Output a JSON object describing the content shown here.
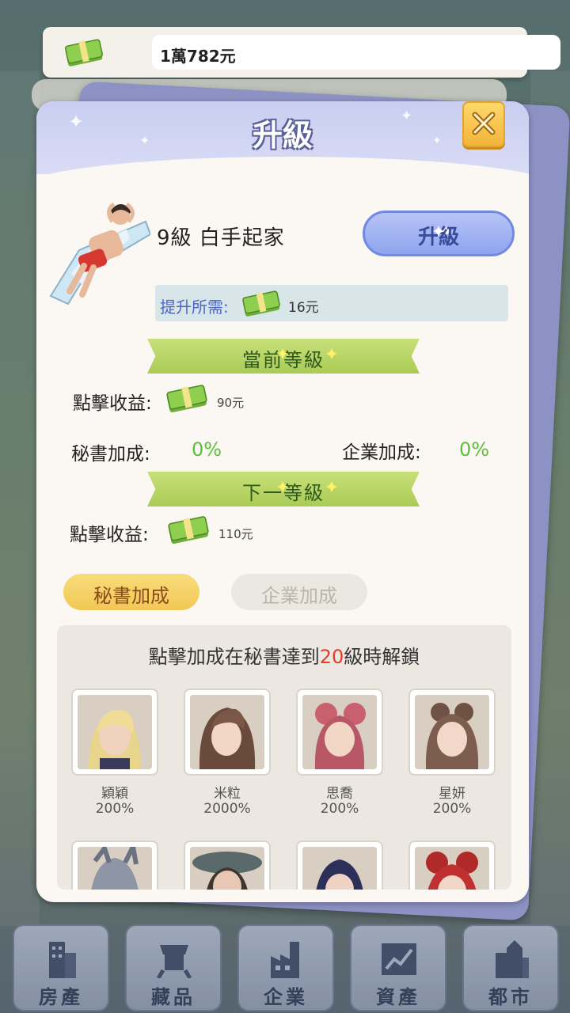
{
  "top_bar": {
    "balance": "1萬782元"
  },
  "dialog": {
    "title": "升級",
    "level_text": "9級  白手起家",
    "upgrade_button": "升級",
    "requirement_label": "提升所需:",
    "requirement_value": "16元",
    "current_level_ribbon": "當前等級",
    "current_click_label": "點擊收益:",
    "current_click_value": "90元",
    "secretary_bonus_label": "秘書加成:",
    "secretary_bonus_value": "0%",
    "corp_bonus_label": "企業加成:",
    "corp_bonus_value": "0%",
    "next_level_ribbon": "下一等級",
    "next_click_label": "點擊收益:",
    "next_click_value": "110元",
    "tabs": {
      "secretary": "秘書加成",
      "corporate": "企業加成"
    },
    "unlock_message": {
      "prefix": "點擊加成在秘書達到",
      "level": "20",
      "suffix": "級時解鎖"
    },
    "secretaries": [
      {
        "name": "穎穎",
        "bonus": "200%"
      },
      {
        "name": "米粒",
        "bonus": "2000%"
      },
      {
        "name": "思喬",
        "bonus": "200%"
      },
      {
        "name": "星妍",
        "bonus": "200%"
      }
    ]
  },
  "bottom_nav": [
    {
      "label": "房產",
      "icon": "building-icon"
    },
    {
      "label": "藏品",
      "icon": "vase-icon"
    },
    {
      "label": "企業",
      "icon": "factory-icon"
    },
    {
      "label": "資產",
      "icon": "chart-icon"
    },
    {
      "label": "都市",
      "icon": "city-icon"
    }
  ],
  "colors": {
    "accent_blue": "#8ea4ee",
    "ribbon_green": "#aacb55",
    "bonus_green": "#5cbf3a",
    "highlight_red": "#e0402a"
  }
}
